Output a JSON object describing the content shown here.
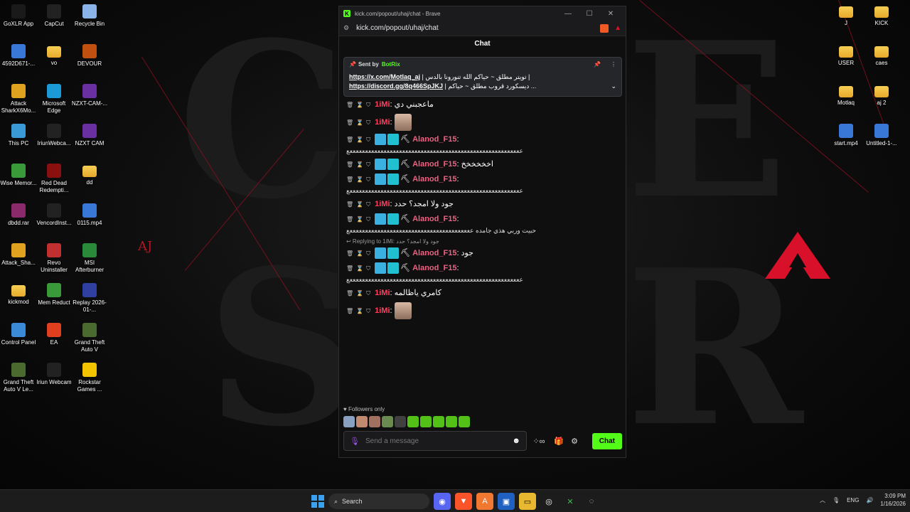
{
  "desktop": {
    "left_icons": [
      {
        "label": "GoXLR App",
        "icon": "goxlr-icon"
      },
      {
        "label": "CapCut",
        "icon": "capcut-icon"
      },
      {
        "label": "Recycle Bin",
        "icon": "recycle-bin-icon"
      },
      {
        "label": "4592D671-...",
        "icon": "file-icon"
      },
      {
        "label": "vo",
        "icon": "folder-icon"
      },
      {
        "label": "DEVOUR",
        "icon": "devour-icon"
      },
      {
        "label": "Attack SharkX6Mo...",
        "icon": "attack-shark-icon"
      },
      {
        "label": "Microsoft Edge",
        "icon": "edge-icon"
      },
      {
        "label": "NZXT-CAM-...",
        "icon": "nzxt-icon"
      },
      {
        "label": "This PC",
        "icon": "pc-icon"
      },
      {
        "label": "IriunWebca...",
        "icon": "iriun-icon"
      },
      {
        "label": "NZXT CAM",
        "icon": "nzxt-icon"
      },
      {
        "label": "Wise Memor...",
        "icon": "wise-icon"
      },
      {
        "label": "Red Dead Redempti...",
        "icon": "rdr-icon"
      },
      {
        "label": "dd",
        "icon": "folder-icon"
      },
      {
        "label": "dbdd.rar",
        "icon": "rar-icon"
      },
      {
        "label": "VencordInst...",
        "icon": "vencord-icon"
      },
      {
        "label": "0115.mp4",
        "icon": "video-file-icon"
      },
      {
        "label": "Attack_Sha...",
        "icon": "attack-shark-icon"
      },
      {
        "label": "Revo Uninstaller",
        "icon": "revo-icon"
      },
      {
        "label": "MSI Afterburner",
        "icon": "msi-icon"
      },
      {
        "label": "kickmod",
        "icon": "folder-icon"
      },
      {
        "label": "Mem Reduct",
        "icon": "memreduct-icon"
      },
      {
        "label": "Replay 2026-01-...",
        "icon": "replay-icon"
      },
      {
        "label": "Control Panel",
        "icon": "control-panel-icon"
      },
      {
        "label": "EA",
        "icon": "ea-icon"
      },
      {
        "label": "Grand Theft Auto V",
        "icon": "gta-icon"
      },
      {
        "label": "Grand Theft Auto V Le...",
        "icon": "gta-icon"
      },
      {
        "label": "Iriun Webcam",
        "icon": "iriun-icon"
      },
      {
        "label": "Rockstar Games ...",
        "icon": "rockstar-icon"
      }
    ],
    "right_icons": [
      {
        "label": "J",
        "icon": "folder-icon"
      },
      {
        "label": "KICK",
        "icon": "folder-icon"
      },
      {
        "label": "USER",
        "icon": "folder-icon"
      },
      {
        "label": "caes",
        "icon": "folder-icon"
      },
      {
        "label": "Motlaq",
        "icon": "folder-icon"
      },
      {
        "label": "aj 2",
        "icon": "folder-icon"
      },
      {
        "label": "start.mp4",
        "icon": "video-file-icon"
      },
      {
        "label": "Untitled-1-...",
        "icon": "video-file-icon"
      }
    ],
    "wallpaper_logo": "AJ"
  },
  "browser": {
    "window_title": "kick.com/popout/uhaj/chat - Brave",
    "url": "kick.com/popout/uhaj/chat"
  },
  "chat": {
    "header": "Chat",
    "pinned": {
      "sent_by_label": "Sent by",
      "bot_name": "BotRix",
      "line1_link": "https://x.com/Motlaq_aj",
      "line1_text": "| تويتر مطلق ~ حياكم الله تنورونا بالدس |",
      "line2_link": "https://discord.gg/8q466SpJKJ",
      "line2_text": "| ديسكورد قروب مطلق ~ حياكم ..."
    },
    "messages": [
      {
        "user": "1iMi",
        "text": "ماعجبني دي"
      },
      {
        "user": "1iMi",
        "text": ""
      },
      {
        "user": "Alanod_F15",
        "text": "ععععععععععععععععععععععععععععععععععععععععععععععععععععععععع"
      },
      {
        "user": "Alanod_F15",
        "text": "اخخخخخخ"
      },
      {
        "user": "Alanod_F15",
        "text": "ععععععععععععععععععععععععععععععععععععععععععععععععععععععععع"
      },
      {
        "user": "1iMi",
        "text": "جود ولا امجد؟ حدد"
      },
      {
        "user": "Alanod_F15",
        "text": "حبيت وربي هذي جامده ععععععععععععععععععععععععععععععععععععععععع"
      },
      {
        "user": "Alanod_F15",
        "text": "جود",
        "reply_to": "Replying to 1iMi: جود ولا امجد؟ حدد"
      },
      {
        "user": "Alanod_F15",
        "text": "ععععععععععععععععععععععععععععععععععععععععععععععععععععععععع"
      },
      {
        "user": "1iMi",
        "text": "كامري ياظالمه"
      },
      {
        "user": "1iMi",
        "text": ""
      }
    ],
    "followers_only": "Followers only",
    "input_placeholder": "Send a message",
    "send_label": "Chat"
  },
  "taskbar": {
    "search_label": "Search",
    "language": "ENG",
    "time": "3:09 PM",
    "date": "1/16/2026"
  },
  "colors": {
    "kick_green": "#53fc18",
    "alanod_color": "#f06080",
    "imi_color": "#ff4060"
  }
}
